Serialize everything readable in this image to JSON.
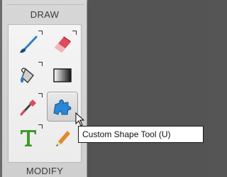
{
  "panel": {
    "draw_header": "DRAW",
    "modify_header": "MODIFY"
  },
  "tools": [
    {
      "name": "brush",
      "icon": "brush-icon"
    },
    {
      "name": "eraser",
      "icon": "eraser-icon"
    },
    {
      "name": "paint-bucket",
      "icon": "paint-bucket-icon"
    },
    {
      "name": "gradient",
      "icon": "gradient-icon"
    },
    {
      "name": "eyedropper",
      "icon": "eyedropper-icon"
    },
    {
      "name": "custom-shape",
      "icon": "puzzle-piece-icon",
      "selected": true
    },
    {
      "name": "type",
      "icon": "type-t-icon"
    },
    {
      "name": "pencil",
      "icon": "pencil-icon"
    }
  ],
  "tooltip": {
    "text": "Custom Shape Tool (U)"
  },
  "colors": {
    "panel_bg": "#d7d7d7",
    "canvas_bg": "#545454",
    "brush_blue": "#2f7fc6",
    "eraser_red": "#e04a5a",
    "shape_blue": "#2a86d6",
    "type_green": "#3f9a2e"
  }
}
